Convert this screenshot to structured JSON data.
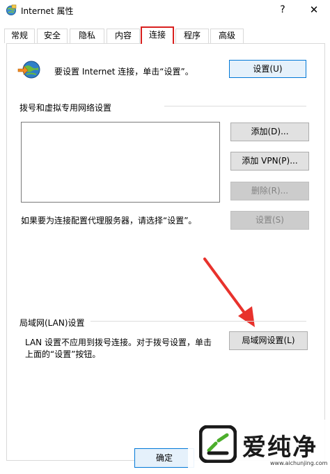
{
  "window": {
    "title": "Internet 属性",
    "help_label": "?",
    "close_label": "✕"
  },
  "tabs": [
    {
      "label": "常规",
      "active": false
    },
    {
      "label": "安全",
      "active": false
    },
    {
      "label": "隐私",
      "active": false
    },
    {
      "label": "内容",
      "active": false
    },
    {
      "label": "连接",
      "active": true
    },
    {
      "label": "程序",
      "active": false
    },
    {
      "label": "高级",
      "active": false
    }
  ],
  "setup": {
    "text": "要设置 Internet 连接，单击“设置”。",
    "button_label": "设置(U)"
  },
  "dialup": {
    "group_title": "拨号和虚拟专用网络设置",
    "add_label": "添加(D)...",
    "add_vpn_label": "添加 VPN(P)...",
    "delete_label": "删除(R)...",
    "proxy_text": "如果要为连接配置代理服务器，请选择“设置”。",
    "settings_label": "设置(S)"
  },
  "lan": {
    "group_title": "局域网(LAN)设置",
    "desc_line1": "LAN 设置不应用到拨号连接。对于拨号设置，单击",
    "desc_line2": "上面的“设置”按钮。",
    "button_label": "局域网设置(L)"
  },
  "footer": {
    "ok_label": "确定"
  },
  "watermark": {
    "name": "爱纯净",
    "url": "www.aichunjing.com"
  },
  "colors": {
    "highlight": "#d9201e",
    "primary_border": "#0078d7"
  }
}
